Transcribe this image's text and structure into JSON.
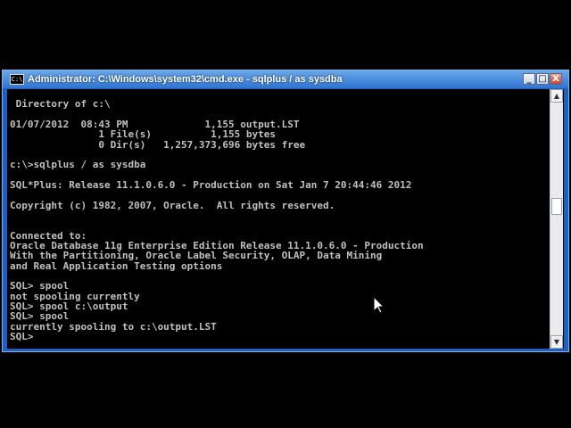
{
  "window": {
    "title": "Administrator: C:\\Windows\\system32\\cmd.exe - sqlplus  / as sysdba",
    "icon_label": "C:\\",
    "buttons": {
      "minimize": "_",
      "maximize": "□",
      "close": "X"
    }
  },
  "console": {
    "lines": [
      "",
      " Directory of c:\\",
      "",
      "01/07/2012  08:43 PM             1,155 output.LST",
      "               1 File(s)          1,155 bytes",
      "               0 Dir(s)   1,257,373,696 bytes free",
      "",
      "c:\\>sqlplus / as sysdba",
      "",
      "SQL*Plus: Release 11.1.0.6.0 - Production on Sat Jan 7 20:44:46 2012",
      "",
      "Copyright (c) 1982, 2007, Oracle.  All rights reserved.",
      "",
      "",
      "Connected to:",
      "Oracle Database 11g Enterprise Edition Release 11.1.0.6.0 - Production",
      "With the Partitioning, Oracle Label Security, OLAP, Data Mining",
      "and Real Application Testing options",
      "",
      "SQL> spool",
      "not spooling currently",
      "SQL> spool c:\\output",
      "SQL> spool",
      "currently spooling to c:\\output.LST",
      "SQL> "
    ]
  },
  "scrollbar": {
    "up_arrow": "▲",
    "down_arrow": "▼",
    "position": 0.45
  }
}
